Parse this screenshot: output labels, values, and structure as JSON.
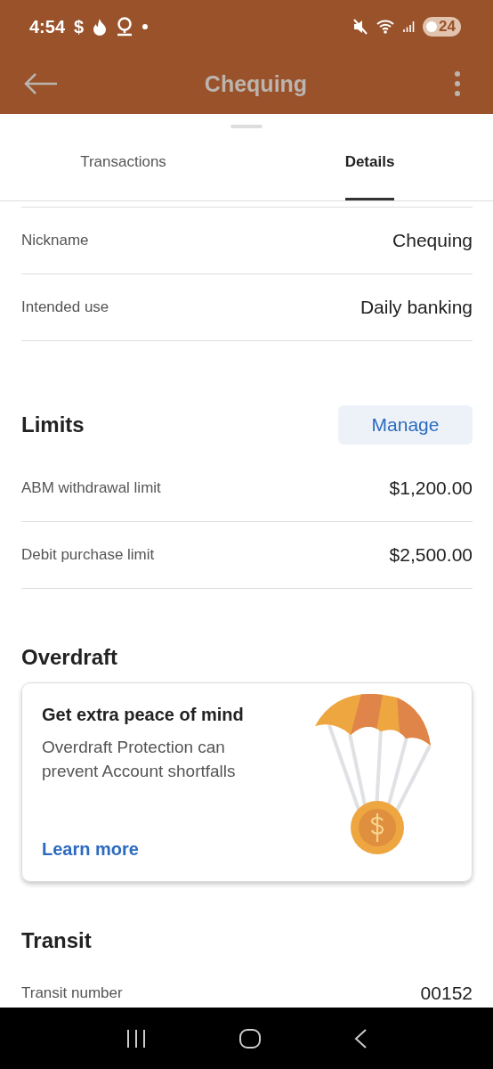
{
  "status_bar": {
    "time": "4:54",
    "notification": "$",
    "battery": "24"
  },
  "app_bar": {
    "title": "Chequing"
  },
  "tabs": [
    {
      "label": "Transactions",
      "selected": false
    },
    {
      "label": "Details",
      "selected": true
    }
  ],
  "account_rows": [
    {
      "label": "Nickname",
      "value": "Chequing"
    },
    {
      "label": "Intended use",
      "value": "Daily banking"
    }
  ],
  "limits": {
    "title": "Limits",
    "action": "Manage",
    "rows": [
      {
        "label": "ABM withdrawal limit",
        "value": "$1,200.00"
      },
      {
        "label": "Debit purchase limit",
        "value": "$2,500.00"
      }
    ]
  },
  "overdraft": {
    "title": "Overdraft",
    "card": {
      "heading": "Get extra peace of mind",
      "body": "Overdraft Protection can prevent Account shortfalls",
      "link": "Learn more"
    }
  },
  "transit": {
    "title": "Transit",
    "rows": [
      {
        "label": "Transit number",
        "value": "00152"
      }
    ]
  }
}
